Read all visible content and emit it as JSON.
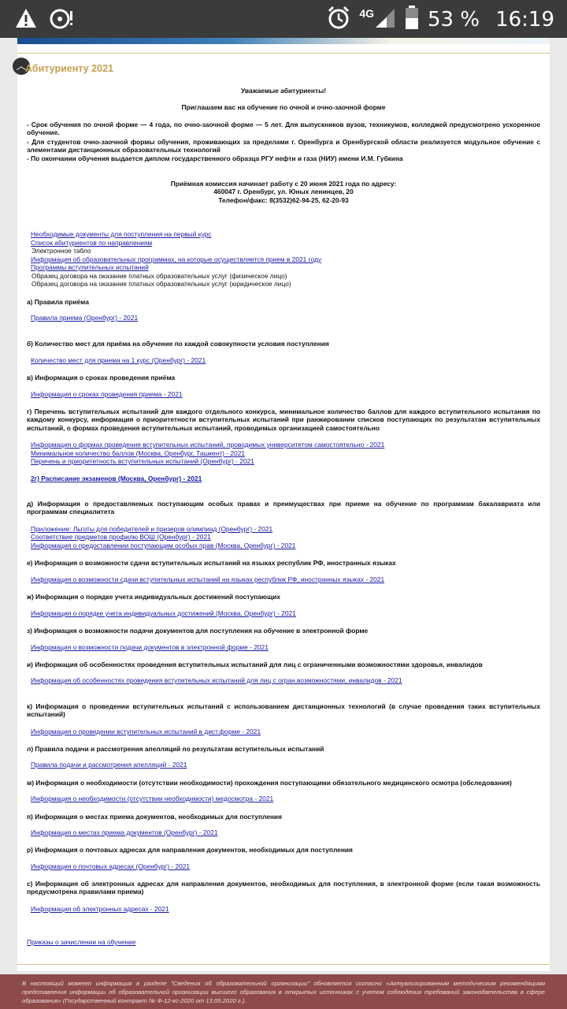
{
  "status": {
    "network": "4G",
    "battery": "53 %",
    "time": "16:19",
    "icons": [
      "warning-icon",
      "hotspot-icon",
      "alarm-icon",
      "signal-icon",
      "battery-icon"
    ]
  },
  "header": {
    "title": "Абитуриенту 2021"
  },
  "intro": {
    "greeting": "Уважаемые абитуриенты!",
    "invite": "Приглашаем вас на обучение по очной и очно-заочной форме",
    "bullets": [
      "- Срок обучения по очной форме — 4 года, по очно-заочной форме — 5 лет. Для выпускников вузов, техникумов, колледжей предусмотрено ускоренное обучение.",
      "- Для студентов очно-заочной формы обучения, проживающих за пределами г. Оренбурга и Оренбургской области реализуется модульное обучение с элементами дистанционных образовательных технологий",
      "- По окончании обучения выдается диплом государственного образца РГУ нефти и газа (НИУ) имени И.М. Губкина"
    ],
    "address_1": "Приёмная комиссия начинает работу с 20 июня 2021 года по адресу:",
    "address_2": "460047 г. Оренбург, ул. Юных ленинцев, 20",
    "address_3": "Телефон/факс: 8(3532)62-94-25, 62-20-93"
  },
  "top_links": [
    {
      "text": "Необходимые документы для поступления на первый курс",
      "link": true
    },
    {
      "text": "Список абитуриентов по направлениям",
      "link": true
    },
    {
      "text": "Электронное табло",
      "link": false
    },
    {
      "text": "Информация об образовательных программах, на которые осуществляется прием в 2021 году",
      "link": true
    },
    {
      "text": "Программы вступительных испытаний",
      "link": true
    },
    {
      "text": "Образец договора на оказание платных образовательных услуг (физическое лицо)",
      "link": false
    },
    {
      "text": "Образец договора на оказание платных образовательных услуг (юридическое лицо)",
      "link": false
    }
  ],
  "sections": {
    "a": {
      "heading": "а) Правила приёма",
      "links": [
        "Правила приема (Оренбург) - 2021"
      ]
    },
    "b": {
      "heading": "б) Количество мест для приёма на обучение по каждой совокупности условия поступления",
      "links": [
        "Количество мест для приема на 1 курс (Оренбург) - 2021"
      ]
    },
    "v": {
      "heading": "в) Информация о сроках проведения приёма",
      "links": [
        "Информация о сроках проведения приема - 2021"
      ]
    },
    "g": {
      "heading": "г) Перечень вступительных испытаний для каждого отдельного конкурса, минимальное количество баллов для каждого вступительного испытания по каждому конкурсу, информация о приоритетности вступительных испытаний при ранжировании списков поступающих по результатам вступительных испытаний, о формах проведения вступительных испытаний, проводимых организацией самостоятельно",
      "links": [
        "Информация о формах проведения вступительных испытаний, проводимых университетом самостоятельно - 2021",
        "Минимальное количество баллов (Москва, Оренбург, Ташкент) - 2021",
        "Перечень и приоритетность вступительных испытаний (Оренбург) - 2021"
      ],
      "extra": "2г) Расписание экзаменов (Москва, Оренбург) - 2021"
    },
    "d": {
      "heading": "д) Информация о предоставляемых поступающим особых правах и преимуществах при приеме на обучение по программам бакалавриата или программам специалитета",
      "links": [
        "Приложение: Льготы для победителей и призеров олимпиад (Оренбург) - 2021",
        "Соответствие предметов профилю ВОШ (Оренбург) - 2021",
        "Информация о предоставлении поступающим особых прав (Москва, Оренбург) - 2021"
      ]
    },
    "e": {
      "heading": "е) Информация о возможности сдачи вступительных испытаний на языках республик РФ, иностранных языках",
      "links": [
        "Информация о возможности сдачи вступительных испытаний на языках республик РФ, иностранных языках - 2021"
      ]
    },
    "zh": {
      "heading": "ж) Информация о порядке учета индивидуальных достижений поступающих",
      "links": [
        "Информация о порядке учета индивидуальных достижений (Москва, Оренбург) - 2021"
      ]
    },
    "z": {
      "heading": "з) Информация о возможности подачи документов для поступления на обучение в электронной форме",
      "links": [
        "Информация о возможности подачи документов в электронной форме - 2021"
      ]
    },
    "i": {
      "heading": "и) Информация об особенностях проведения вступительных испытаний для лиц с ограниченными возможностями здоровья, инвалидов",
      "links": [
        "Информация об особенностях проведения вступительных испытаний для лиц с огран.возможностями, инвалидов - 2021"
      ]
    },
    "k": {
      "heading": "к) Информация о проведении вступительных испытаний с использованием дистанционных технологий (в случае проведения таких вступительных испытаний)",
      "links": [
        "Информация о проведении вступительных испытаний в дист.форме - 2021"
      ]
    },
    "l": {
      "heading": "л) Правила подачи и рассмотрения апелляций по результатам вступительных испытаний",
      "links": [
        "Правила подачи и рассмотрения апелляций - 2021"
      ]
    },
    "m": {
      "heading": "м) Информация о необходимости (отсутствии необходимости) прохождения поступающими обязательного медицинского осмотра (обследования)",
      "links": [
        "Информация о необходимости (отсутствии необходимости) медосмотра - 2021"
      ]
    },
    "p": {
      "heading": "п) Информация о местах приема документов, необходимых для поступления",
      "links": [
        "Информация о местах приема документов (Оренбург) - 2021"
      ]
    },
    "r": {
      "heading": "р) Информация о почтовых адресах для направления документов, необходимых для поступления",
      "links": [
        "Информация о почтовых адресах (Оренбург) - 2021"
      ]
    },
    "s": {
      "heading": "с) Информация об электронных адресах для направления документов, необходимых для поступления, в электронной форме (если такая возможность предусмотрена правилами приема)",
      "links": [
        "Информация об электронных адресах - 2021"
      ]
    }
  },
  "orders_link": "Приказы о зачислении на обучение",
  "footer": "В настоящий момент информация в разделе \"Сведения об образовательной организации\" обновляется согласно «Актуализированным методическим рекомендациям представления информации об образовательной организации высшего образования в открытых источниках с учетом соблюдения требований законодательства в сфере образования» (Государственный контракт № Ф-12-кс-2020 от 13.05.2020 г.)."
}
